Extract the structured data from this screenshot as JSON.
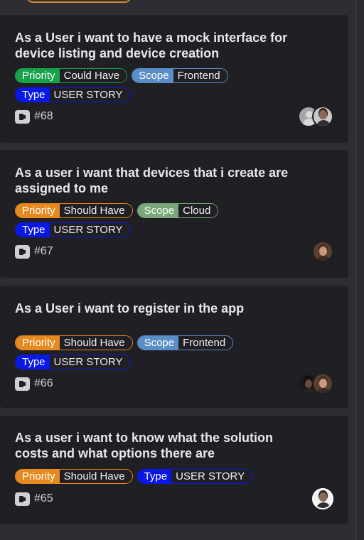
{
  "cards": [
    {
      "title": "As a User i want to have a mock interface for device listing and device creation",
      "issue": "#68",
      "tags_row1": [
        {
          "key": "Priority",
          "value": "Could Have",
          "color": "#16a34a"
        },
        {
          "key": "Scope",
          "value": "Frontend",
          "color": "#5a8ec8"
        }
      ],
      "tags_row2": [
        {
          "key": "Type",
          "value": "USER STORY",
          "color": "#0a18e6"
        }
      ]
    },
    {
      "title": "As a user i want that devices that i create are assigned to me",
      "issue": "#67",
      "tags_row1": [
        {
          "key": "Priority",
          "value": "Should Have",
          "color": "#e68a1f"
        },
        {
          "key": "Scope",
          "value": "Cloud",
          "color": "#7aa87a"
        }
      ],
      "tags_row2": [
        {
          "key": "Type",
          "value": "USER STORY",
          "color": "#0a18e6"
        }
      ]
    },
    {
      "title": "As a User i want to register in the app",
      "issue": "#66",
      "tags_row1": [
        {
          "key": "Priority",
          "value": "Should Have",
          "color": "#e68a1f"
        },
        {
          "key": "Scope",
          "value": "Frontend",
          "color": "#5a8ec8"
        }
      ],
      "tags_row2": [
        {
          "key": "Type",
          "value": "USER STORY",
          "color": "#0a18e6"
        }
      ]
    },
    {
      "title": "As a user i want to know what the solution costs and what options there are",
      "issue": "#65",
      "tags_row1": [
        {
          "key": "Priority",
          "value": "Should Have",
          "color": "#e68a1f"
        },
        {
          "key": "Type",
          "value": "USER STORY",
          "color": "#0a18e6"
        }
      ],
      "tags_row2": []
    }
  ]
}
